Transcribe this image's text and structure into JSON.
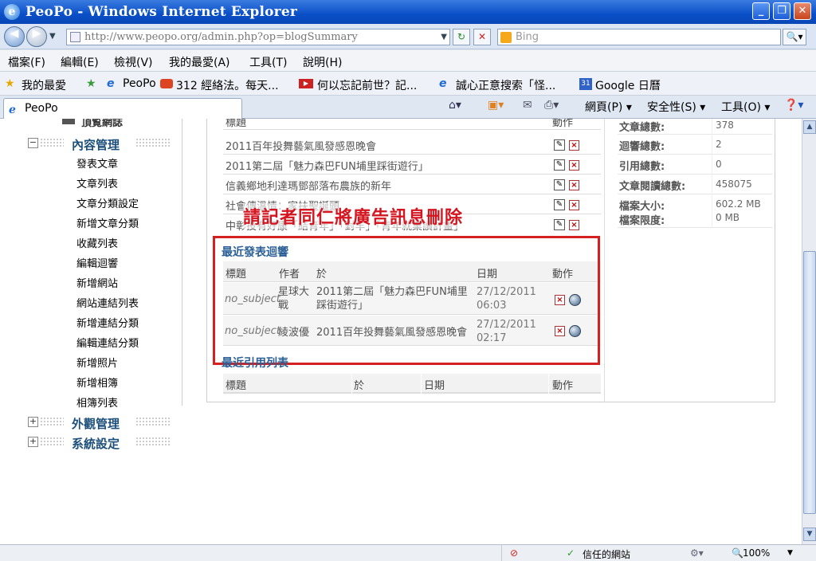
{
  "window": {
    "title": "PeoPo - Windows Internet Explorer"
  },
  "address": {
    "url": "http://www.peopo.org/admin.php?op=blogSummary",
    "search_placeholder": "Bing"
  },
  "menu": [
    "檔案(F)",
    "編輯(E)",
    "檢視(V)",
    "我的最愛(A)",
    "工具(T)",
    "說明(H)"
  ],
  "favorites": {
    "label": "我的最愛",
    "items": [
      "PeoPo",
      "312 經絡法。每天...",
      "何以忘記前世？記...",
      "誠心正意搜索「怪...",
      "Google 日曆"
    ]
  },
  "tab": {
    "title": "PeoPo"
  },
  "toolbar": {
    "page": "網頁(P)",
    "safety": "安全性(S)",
    "tools": "工具(O)"
  },
  "sidebar": {
    "top_cut": "頂覧網誌",
    "section": "內容管理",
    "items": [
      "發表文章",
      "文章列表",
      "文章分類設定",
      "新增文章分類",
      "收藏列表",
      "編輯迴響",
      "新增網站",
      "網站連結列表",
      "新增連結分類",
      "編輯連結分類",
      "新增照片",
      "新增相簿",
      "相簿列表"
    ],
    "sections": [
      "外觀管理",
      "系統設定"
    ]
  },
  "articles": {
    "header_title": "標題",
    "header_action": "動作",
    "rows": [
      "2011百年投舞藝氣風發感恩晚會",
      "2011第二屆「魅力森巴FUN埔里踩街遊行」",
      "信義鄉地利達瑪鄧部落布農族的新年",
      "社會傳溫情：家扶聖誕頭",
      "中彰投有好康「結青年」「對羊」「青年就業讀計畫」"
    ]
  },
  "annotation": "請記者同仁將廣告訊息刪除",
  "recent_comments": {
    "title": "最近發表迴響",
    "headers": {
      "title": "標題",
      "author": "作者",
      "on": "於",
      "date": "日期",
      "action": "動作"
    },
    "rows": [
      {
        "subject": "no_subject",
        "author": "星球大戰",
        "on": "2011第二屆「魅力森巴FUN埔里踩街遊行」",
        "date": "27/12/2011 06:03"
      },
      {
        "subject": "no_subject",
        "author": "綾波優",
        "on": "2011百年投舞藝氣風發感恩晚會",
        "date": "27/12/2011 02:17"
      }
    ]
  },
  "recent_trackbacks": {
    "title": "最近引用列表",
    "headers": {
      "title": "標題",
      "on": "於",
      "date": "日期",
      "action": "動作"
    }
  },
  "stats": [
    {
      "label": "文章總數:",
      "value": "378"
    },
    {
      "label": "迴響總數:",
      "value": "2"
    },
    {
      "label": "引用總數:",
      "value": "0"
    },
    {
      "label": "文章閱讀總數:",
      "value": "458075"
    },
    {
      "label": "檔案大小:",
      "value": "602.2 MB"
    },
    {
      "label": "檔案限度:",
      "value": "0 MB"
    }
  ],
  "status": {
    "zone": "信任的網站",
    "zoom": "100%"
  },
  "colors": {
    "annotation_red": "#d4141e",
    "box_red": "#d42020",
    "section_blue": "#1c4f7a"
  }
}
